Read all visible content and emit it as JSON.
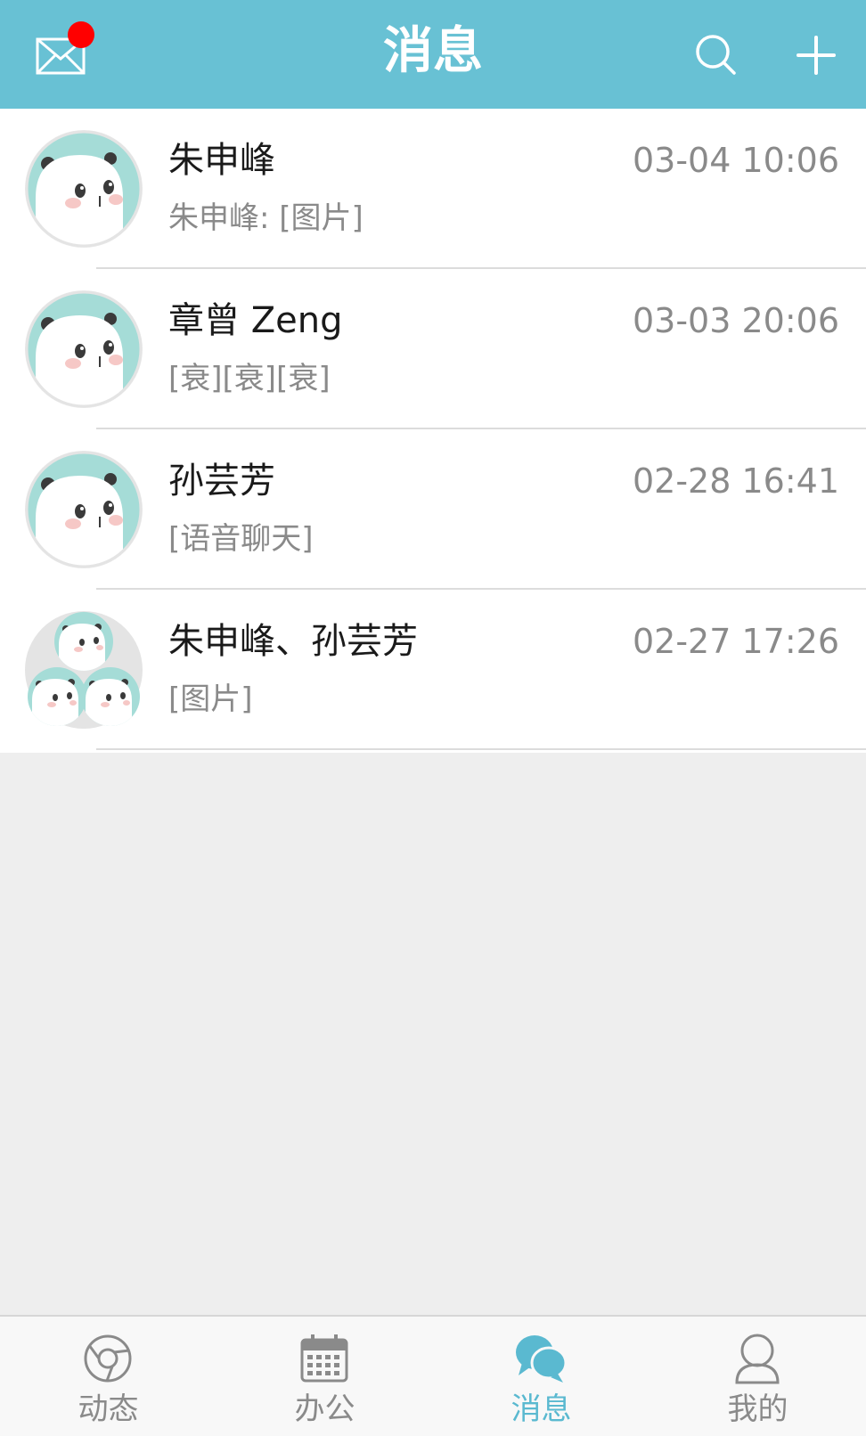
{
  "header": {
    "title": "消息",
    "mail_icon": "mail-icon",
    "search_icon": "search-icon",
    "add_icon": "plus-icon",
    "background": "#68c1d4",
    "badge_color": "#ff0000"
  },
  "conversations": [
    {
      "name": "朱申峰",
      "preview": "朱申峰: [图片]",
      "time": "03-04 10:06",
      "avatar": "panda-avatar"
    },
    {
      "name": "章曾 Zeng",
      "preview": "[衰][衰][衰]",
      "time": "03-03 20:06",
      "avatar": "panda-avatar"
    },
    {
      "name": "孙芸芳",
      "preview": "[语音聊天]",
      "time": "02-28 16:41",
      "avatar": "panda-avatar"
    },
    {
      "name": "朱申峰、孙芸芳",
      "preview": "[图片]",
      "time": "02-27 17:26",
      "avatar": "group-avatar"
    }
  ],
  "tabs": [
    {
      "label": "动态",
      "icon": "feed-icon",
      "active": false
    },
    {
      "label": "办公",
      "icon": "calendar-icon",
      "active": false
    },
    {
      "label": "消息",
      "icon": "chat-icon",
      "active": true
    },
    {
      "label": "我的",
      "icon": "profile-icon",
      "active": false
    }
  ],
  "colors": {
    "accent": "#5ab9d0",
    "inactive": "#8a8a8a"
  }
}
